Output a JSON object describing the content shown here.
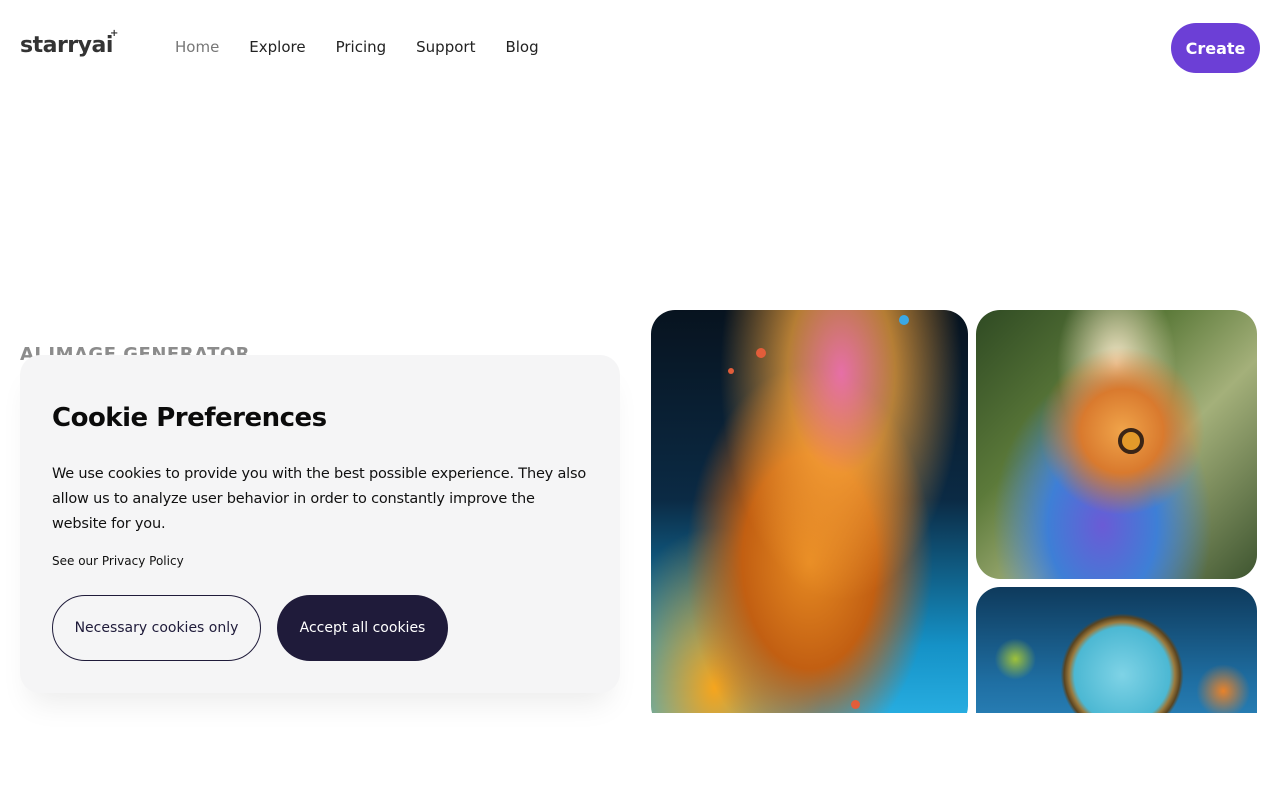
{
  "header": {
    "logo_text": "starryai",
    "nav": [
      {
        "label": "Home",
        "active": true
      },
      {
        "label": "Explore",
        "active": false
      },
      {
        "label": "Pricing",
        "active": false
      },
      {
        "label": "Support",
        "active": false
      },
      {
        "label": "Blog",
        "active": false
      }
    ],
    "create_label": "Create"
  },
  "hero": {
    "label": "AI IMAGE GENERATOR"
  },
  "cookie_modal": {
    "title": "Cookie Preferences",
    "body": "We use cookies to provide you with the best possible experience. They also allow us to analyze user behavior in order to constantly improve the website for you.",
    "policy_link": "See our Privacy Policy",
    "necessary_label": "Necessary cookies only",
    "accept_label": "Accept all cookies"
  },
  "colors": {
    "brand": "#6c3fd6",
    "dark_button": "#1f1b3a",
    "modal_bg": "#f5f5f6"
  }
}
